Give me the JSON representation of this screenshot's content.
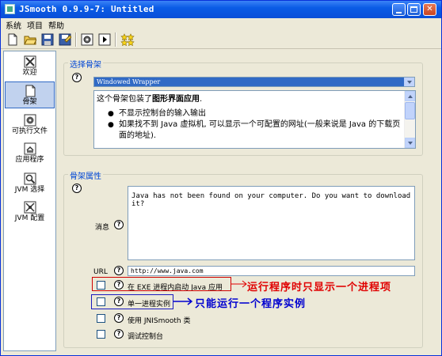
{
  "window": {
    "title": "JSmooth 0.9.9-7: Untitled"
  },
  "menu": {
    "items": [
      "系统",
      "项目",
      "帮助"
    ]
  },
  "toolbar": {
    "buttons": [
      "new-file-icon",
      "open-folder-icon",
      "save-icon",
      "save-as-icon",
      "settings-gear-icon",
      "run-icon",
      "wizard-stars-icon"
    ]
  },
  "sidebar": {
    "items": [
      {
        "label": "欢迎",
        "icon": "welcome-icon",
        "selected": false
      },
      {
        "label": "骨架",
        "icon": "skeleton-icon",
        "selected": true
      },
      {
        "label": "可执行文件",
        "icon": "executable-icon",
        "selected": false
      },
      {
        "label": "应用程序",
        "icon": "application-icon",
        "selected": false
      },
      {
        "label": "JVM 选择",
        "icon": "jvm-select-icon",
        "selected": false
      },
      {
        "label": "JVM 配置",
        "icon": "jvm-config-icon",
        "selected": false
      }
    ]
  },
  "skeleton_select": {
    "legend": "选择骨架",
    "selected": "Windowed Wrapper",
    "description": {
      "intro_prefix": "这个骨架包装了",
      "intro_bold": "图形界面应用",
      "intro_suffix": ".",
      "bullets": [
        "不显示控制台的输入输出",
        "如果找不到 Java 虚拟机, 可以显示一个可配置的网址(一般来说是 Java 的下载页面的地址)."
      ]
    }
  },
  "skeleton_props": {
    "legend": "骨架属性",
    "message_label": "消息",
    "message_value": "Java has not been found on your computer. Do you want to download it?",
    "url_label": "URL",
    "url_value": "http://www.java.com",
    "options": [
      {
        "label": "在 EXE 进程内启动 Java 应用",
        "checked": false
      },
      {
        "label": "单一进程实例",
        "checked": false
      },
      {
        "label": "使用 JNISmooth 类",
        "checked": false
      },
      {
        "label": "调试控制台",
        "checked": false
      }
    ]
  },
  "annotations": {
    "red": "运行程序时只显示一个进程项",
    "blue": "只能运行一个程序实例"
  },
  "colors": {
    "title_blue": "#0a5ce6",
    "selection_blue": "#316ac5",
    "legend_blue": "#0046d5",
    "annotation_red": "#e00000",
    "annotation_blue": "#0000d0"
  }
}
